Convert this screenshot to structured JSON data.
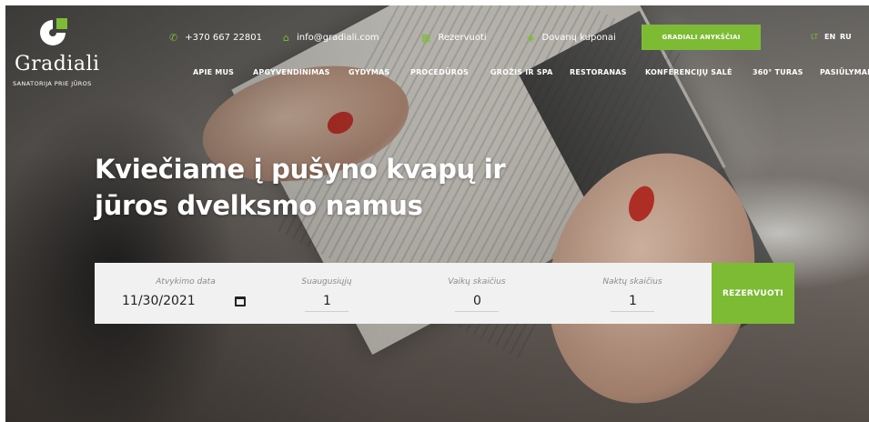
{
  "brand": {
    "logo_text": "Gradiali",
    "tagline": "SANATORIJA PRIE JŪROS",
    "accent": "#7dbb35"
  },
  "contact": {
    "phone": "+370 667 22801",
    "email": "info@gradiali.com",
    "reserve": "Rezervuoti",
    "vouchers": "Dovanų kuponai",
    "phone_icon": "phone-icon",
    "email_icon": "home-icon",
    "reserve_icon": "calendar-icon",
    "vouchers_icon": "gift-icon"
  },
  "cta_label": "GRADIALI ANYKŠČIAI",
  "languages": [
    "LT",
    "EN",
    "RU"
  ],
  "active_language": "LT",
  "nav": [
    "APIE MUS",
    "APGYVENDINIMAS",
    "GYDYMAS",
    "PROCEDŪROS",
    "GROŽIS IR SPA",
    "RESTORANAS",
    "KONFERENCIJŲ SALĖ",
    "360° TURAS",
    "PASIŪLYMAI"
  ],
  "hero": {
    "heading_line1": "Kviečiame į pušyno kvapų ir",
    "heading_line2": "jūros dvelksmo namus"
  },
  "booking": {
    "date_label": "Atvykimo data",
    "date_value": "11/30/2021",
    "adults_label": "Suaugusiųjų",
    "adults_value": "1",
    "children_label": "Vaikų skaičius",
    "children_value": "0",
    "nights_label": "Naktų skaičius",
    "nights_value": "1",
    "submit_label": "REZERVUOTI"
  }
}
